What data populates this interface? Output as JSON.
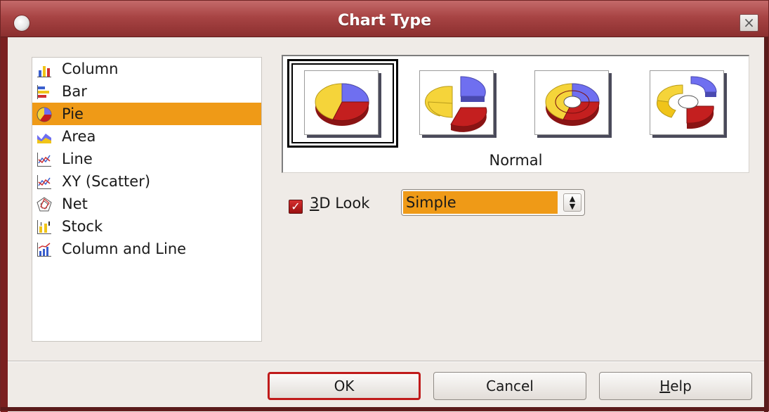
{
  "window": {
    "title": "Chart Type",
    "close_label": "×"
  },
  "chart_types": [
    {
      "label": "Column",
      "icon": "column-chart-icon",
      "selected": false
    },
    {
      "label": "Bar",
      "icon": "bar-chart-icon",
      "selected": false
    },
    {
      "label": "Pie",
      "icon": "pie-chart-icon",
      "selected": true
    },
    {
      "label": "Area",
      "icon": "area-chart-icon",
      "selected": false
    },
    {
      "label": "Line",
      "icon": "line-chart-icon",
      "selected": false
    },
    {
      "label": "XY (Scatter)",
      "icon": "scatter-chart-icon",
      "selected": false
    },
    {
      "label": "Net",
      "icon": "net-chart-icon",
      "selected": false
    },
    {
      "label": "Stock",
      "icon": "stock-chart-icon",
      "selected": false
    },
    {
      "label": "Column and Line",
      "icon": "column-line-chart-icon",
      "selected": false
    }
  ],
  "variants": {
    "caption": "Normal",
    "items": [
      {
        "icon": "pie-normal-icon",
        "selected": true
      },
      {
        "icon": "pie-exploded-icon",
        "selected": false
      },
      {
        "icon": "donut-icon",
        "selected": false
      },
      {
        "icon": "donut-exploded-icon",
        "selected": false
      }
    ]
  },
  "look_3d": {
    "checked": true,
    "label_mnemonic": "3",
    "label_rest": "D Look",
    "select_value": "Simple"
  },
  "buttons": {
    "ok": "OK",
    "cancel": "Cancel",
    "help_mnemonic": "H",
    "help_rest": "elp"
  },
  "colors": {
    "accent": "#ef9a17",
    "titlebar": "#a84444",
    "pie_yellow": "#f5d43a",
    "pie_blue": "#6f6ff0",
    "pie_red": "#c41f1f"
  }
}
